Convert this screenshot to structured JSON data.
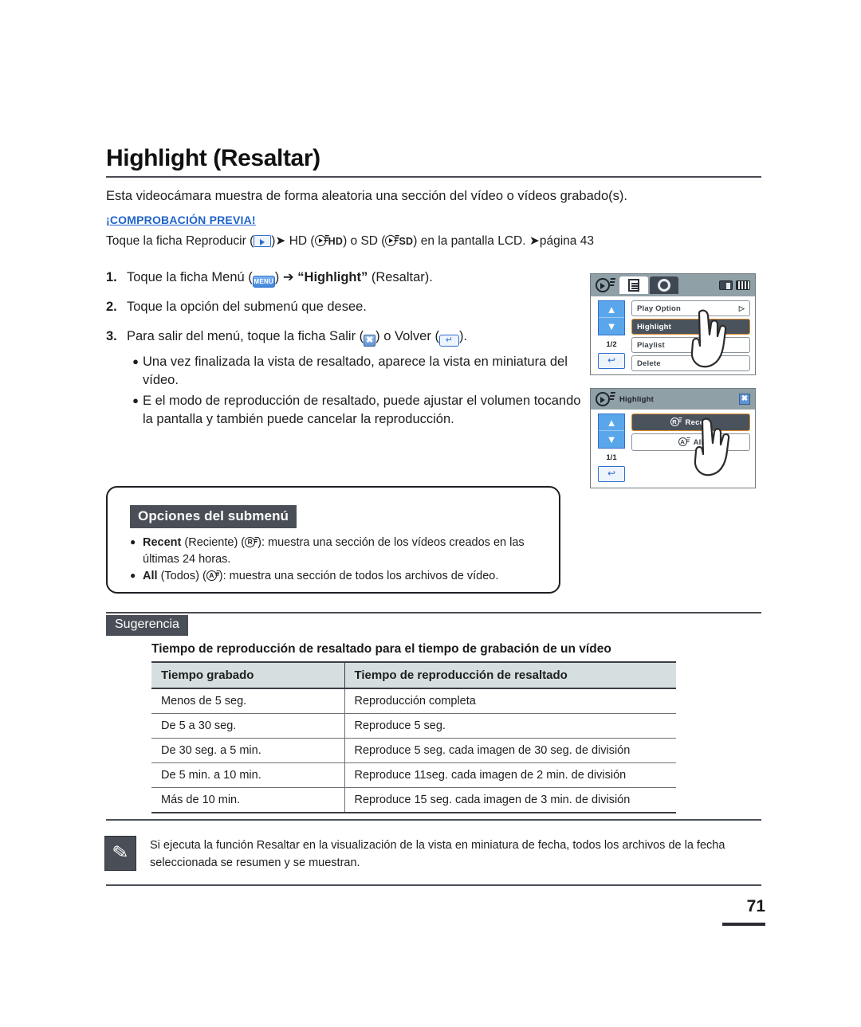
{
  "document": {
    "title": "Highlight (Resaltar)",
    "intro": "Esta videocámara muestra de forma aleatoria una sección del vídeo o vídeos grabado(s).",
    "precheck_label": "¡COMPROBACIÓN PREVIA!",
    "precheck_part1": "Toque la ficha Reproducir (",
    "precheck_part2": ")",
    "precheck_part3": " HD (",
    "precheck_hd": "HD",
    "precheck_part4": ") o SD (",
    "precheck_sd": "SD",
    "precheck_part5": ") en la pantalla LCD. ",
    "precheck_page_ref": "página 43",
    "page_number": "71"
  },
  "steps": [
    {
      "num": "1.",
      "pre": "Toque la ficha Menú (",
      "icon": "menu-icon",
      "icon_label": "MENU",
      "mid": ") ",
      "arrow": "➔",
      "bold": "“Highlight”",
      "post": " (Resaltar)."
    },
    {
      "num": "2.",
      "pre": "Toque la opción del submenú que desee.",
      "icon": "",
      "icon_label": "",
      "mid": "",
      "arrow": "",
      "bold": "",
      "post": ""
    },
    {
      "num": "3.",
      "pre": "Para salir del menú, toque la ficha Salir (",
      "icon": "exit-icon",
      "icon_label": "✖",
      "mid": ") o Volver (",
      "arrow": "",
      "bold": "",
      "post": ")."
    }
  ],
  "step_bullets": [
    "Una vez finalizada la vista de resaltado, aparece la vista en miniatura del vídeo.",
    "E el modo de reproducción de resaltado, puede ajustar el volumen tocando la pantalla y también puede cancelar la reproducción."
  ],
  "submenu_box": {
    "heading": "Opciones del submenú",
    "items": [
      {
        "name": "Recent",
        "translation": "(Reciente)",
        "badge": "R",
        "desc": ": muestra una sección de los vídeos creados en las últimas 24 horas."
      },
      {
        "name": "All",
        "translation": "(Todos)",
        "badge": "A",
        "desc": ": muestra una sección de todos los archivos de vídeo."
      }
    ]
  },
  "suggestion": {
    "tag": "Sugerencia",
    "subtitle": "Tiempo de reproducción de resaltado para el tiempo de grabación de un vídeo",
    "table": {
      "headers": [
        "Tiempo grabado",
        "Tiempo de reproducción de resaltado"
      ],
      "rows": [
        [
          "Menos de 5 seg.",
          "Reproducción completa"
        ],
        [
          "De 5 a 30 seg.",
          "Reproduce 5 seg."
        ],
        [
          "De 30 seg. a 5 min.",
          "Reproduce 5 seg. cada imagen de 30 seg. de división"
        ],
        [
          "De 5 min. a 10 min.",
          "Reproduce 11seg. cada imagen de 2 min. de división"
        ],
        [
          "Más de 10 min.",
          "Reproduce 15 seg. cada imagen de 3 min. de división"
        ]
      ]
    }
  },
  "note": {
    "icon": "note-pencil-icon",
    "text": "Si ejecuta la función Resaltar en la visualización de la vista en miniatura de fecha, todos los archivos de la fecha seleccionada se resumen y se muestran."
  },
  "lcd_screen_1": {
    "tabs": [
      {
        "icon": "play-disc-icon",
        "state": "inactive"
      },
      {
        "icon": "document-icon",
        "state": "active"
      },
      {
        "icon": "gear-icon",
        "state": "dark"
      }
    ],
    "status_icons": [
      "memory-card-icon",
      "battery-icon"
    ],
    "nav": {
      "up": "▲",
      "down": "▼",
      "page": "1/2",
      "back": "↩"
    },
    "menu_items": [
      {
        "label": "Play Option",
        "selected": false,
        "right": "▷"
      },
      {
        "label": "Highlight",
        "selected": true,
        "right": ""
      },
      {
        "label": "Playlist",
        "selected": false,
        "right": ""
      },
      {
        "label": "Delete",
        "selected": false,
        "right": ""
      }
    ]
  },
  "lcd_screen_2": {
    "header_icon": "play-disc-icon",
    "title": "Highlight",
    "close": "✖",
    "nav": {
      "up": "▲",
      "down": "▼",
      "page": "1/1",
      "back": "↩"
    },
    "menu_items": [
      {
        "badge": "R",
        "label": "Recent",
        "selected": true
      },
      {
        "badge": "A",
        "label": "All",
        "selected": false
      }
    ]
  },
  "colors": {
    "accent_blue": "#1f63c8",
    "lcd_header": "#8fa0a6",
    "selected_fill": "#4a535c",
    "selected_border": "#e08a28",
    "dark_tag": "#4a4f57",
    "table_header_bg": "#d5dfe0",
    "button_blue": "#5aa6ea"
  }
}
